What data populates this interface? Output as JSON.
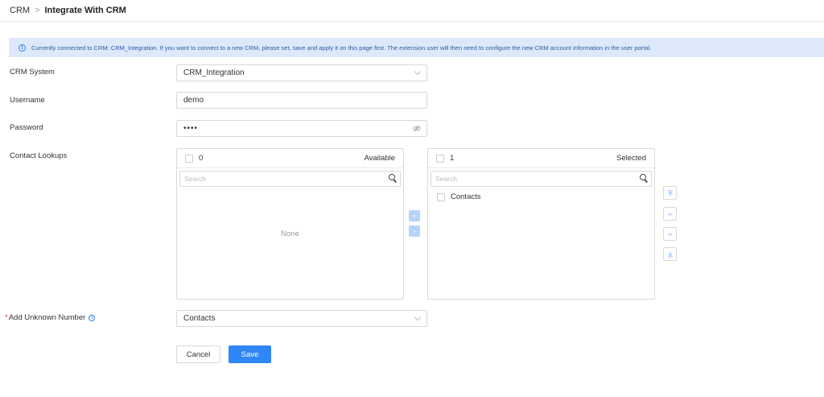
{
  "breadcrumb": {
    "root": "CRM",
    "separator": ">",
    "current": "Integrate With CRM"
  },
  "banner": {
    "text": "Currently connected to CRM: CRM_Integration. If you want to connect to a new CRM, please set, save and apply it on this page first. The extension user will then need to configure the new CRM account information in the user portal."
  },
  "form": {
    "crm_system": {
      "label": "CRM System",
      "value": "CRM_Integration"
    },
    "username": {
      "label": "Username",
      "value": "demo"
    },
    "password": {
      "label": "Password",
      "value": "••••"
    },
    "contact_lookups": {
      "label": "Contact Lookups"
    },
    "add_unknown": {
      "label": "Add Unknown Number",
      "required_mark": "*",
      "value": "Contacts"
    }
  },
  "transfer": {
    "available": {
      "count": "0",
      "title": "Available",
      "search_placeholder": "Search",
      "empty_text": "None"
    },
    "selected": {
      "count": "1",
      "title": "Selected",
      "search_placeholder": "Search",
      "items": [
        "Contacts"
      ]
    }
  },
  "actions": {
    "cancel": "Cancel",
    "save": "Save"
  },
  "colors": {
    "accent": "#2f86f6",
    "banner_bg": "#dde9fb",
    "required": "#e53935"
  }
}
